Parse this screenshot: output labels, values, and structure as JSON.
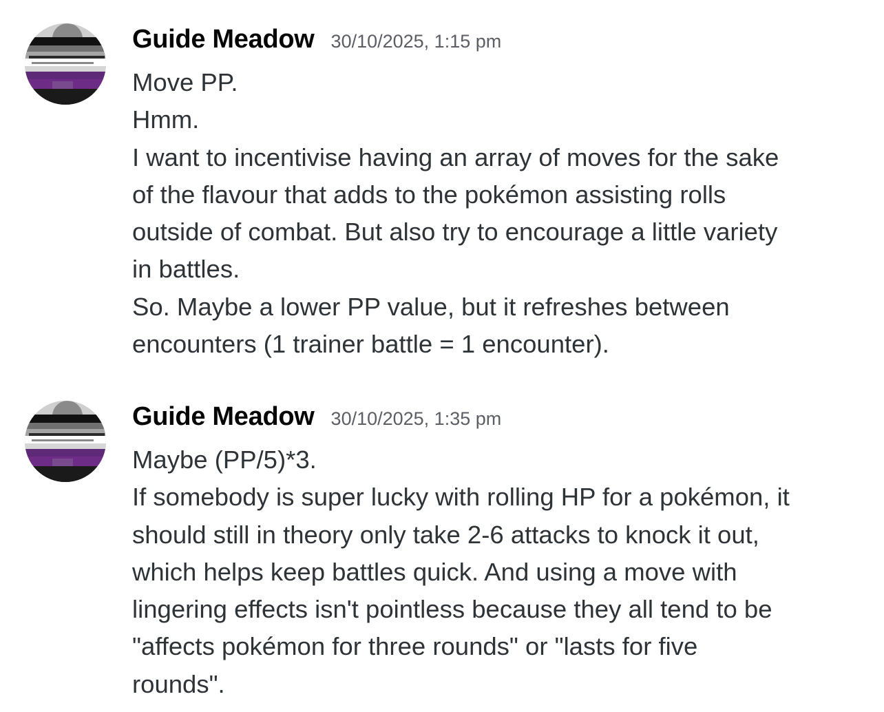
{
  "messages": [
    {
      "username": "Guide Meadow",
      "timestamp": "30/10/2025, 1:15 pm",
      "lines": [
        "Move PP.",
        "Hmm.",
        "I want to incentivise having an array of moves for the sake",
        "of the flavour that adds to the pokémon assisting rolls",
        "outside of combat. But also try to encourage a little variety",
        "in battles.",
        "So. Maybe a lower PP value, but it refreshes between",
        "encounters (1 trainer battle = 1 encounter)."
      ]
    },
    {
      "username": "Guide Meadow",
      "timestamp": "30/10/2025, 1:35 pm",
      "lines": [
        "Maybe (PP/5)*3.",
        "If somebody is super lucky with rolling HP for a pokémon, it",
        "should still in theory only take 2-6 attacks to knock it out,",
        "which helps keep battles quick. And using a move with",
        "lingering effects isn't pointless because they all tend to be",
        "\"affects pokémon for three rounds\" or \"lasts for five",
        "rounds\"."
      ]
    }
  ],
  "avatar": {
    "icon": "user-avatar",
    "stripe_colors": [
      "#111111",
      "#a4a4a4",
      "#ffffff",
      "#6d2c86"
    ]
  }
}
